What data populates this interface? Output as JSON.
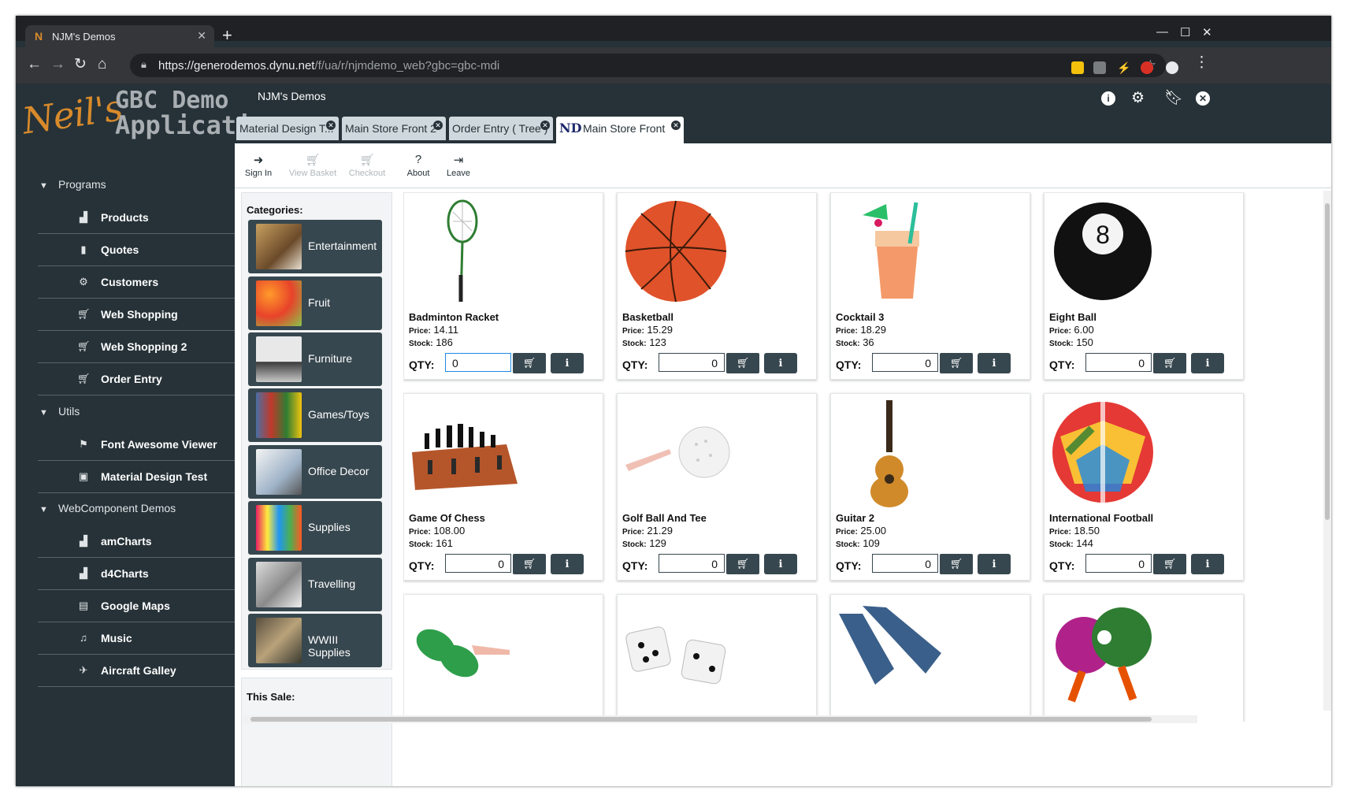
{
  "browser": {
    "tab_title": "NJM's Demos",
    "url_main": "https://generodemos.dynu.net",
    "url_path": "/f/ua/r/njmdemo_web?gbc=gbc-mdi"
  },
  "app": {
    "logo_script": "Neil's",
    "logo_line1": "GBC Demo",
    "logo_line2": "Application",
    "title": "NJM's Demos",
    "window_tabs": [
      "Material Design T...",
      "Main Store Front 2",
      "Order Entry ( Tree )",
      "Main Store Front"
    ]
  },
  "sidebar": {
    "groups": [
      {
        "label": "Programs",
        "items": [
          {
            "label": "Products",
            "icon": "bar-chart-icon"
          },
          {
            "label": "Quotes",
            "icon": "bookmark-icon"
          },
          {
            "label": "Customers",
            "icon": "gear-icon"
          },
          {
            "label": "Web Shopping",
            "icon": "cart-icon"
          },
          {
            "label": "Web Shopping 2",
            "icon": "cart-icon"
          },
          {
            "label": "Order Entry",
            "icon": "cart-icon"
          }
        ]
      },
      {
        "label": "Utils",
        "items": [
          {
            "label": "Font Awesome Viewer",
            "icon": "flag-icon"
          },
          {
            "label": "Material Design Test",
            "icon": "image-icon"
          }
        ]
      },
      {
        "label": "WebComponent Demos",
        "items": [
          {
            "label": "amCharts",
            "icon": "bar-chart-icon"
          },
          {
            "label": "d4Charts",
            "icon": "bar-chart-icon"
          },
          {
            "label": "Google Maps",
            "icon": "map-icon"
          },
          {
            "label": "Music",
            "icon": "music-icon"
          },
          {
            "label": "Aircraft Galley",
            "icon": "plane-icon"
          }
        ]
      }
    ]
  },
  "toolbar": {
    "sign_in": "Sign In",
    "view_basket": "View Basket",
    "checkout": "Checkout",
    "about": "About",
    "leave": "Leave"
  },
  "categories": {
    "header": "Categories:",
    "items": [
      "Entertainment",
      "Fruit",
      "Furniture",
      "Games/Toys",
      "Office Decor",
      "Supplies",
      "Travelling",
      "WWIII Supplies"
    ]
  },
  "sale": {
    "header": "This Sale:"
  },
  "labels": {
    "price": "Price:",
    "stock": "Stock:",
    "qty": "QTY:"
  },
  "products": [
    {
      "name": "Badminton Racket",
      "price": "14.11",
      "stock": "186",
      "qty": "0"
    },
    {
      "name": "Basketball",
      "price": "15.29",
      "stock": "123",
      "qty": "0"
    },
    {
      "name": "Cocktail 3",
      "price": "18.29",
      "stock": "36",
      "qty": "0"
    },
    {
      "name": "Eight Ball",
      "price": "6.00",
      "stock": "150",
      "qty": "0"
    },
    {
      "name": "Game Of Chess",
      "price": "108.00",
      "stock": "161",
      "qty": "0"
    },
    {
      "name": "Golf Ball And Tee",
      "price": "21.29",
      "stock": "129",
      "qty": "0"
    },
    {
      "name": "Guitar 2",
      "price": "25.00",
      "stock": "109",
      "qty": "0"
    },
    {
      "name": "International Football",
      "price": "18.50",
      "stock": "144",
      "qty": "0"
    }
  ],
  "colors": {
    "sidebar_bg": "#263238",
    "button_bg": "#37474f",
    "accent": "#d88a2b"
  }
}
